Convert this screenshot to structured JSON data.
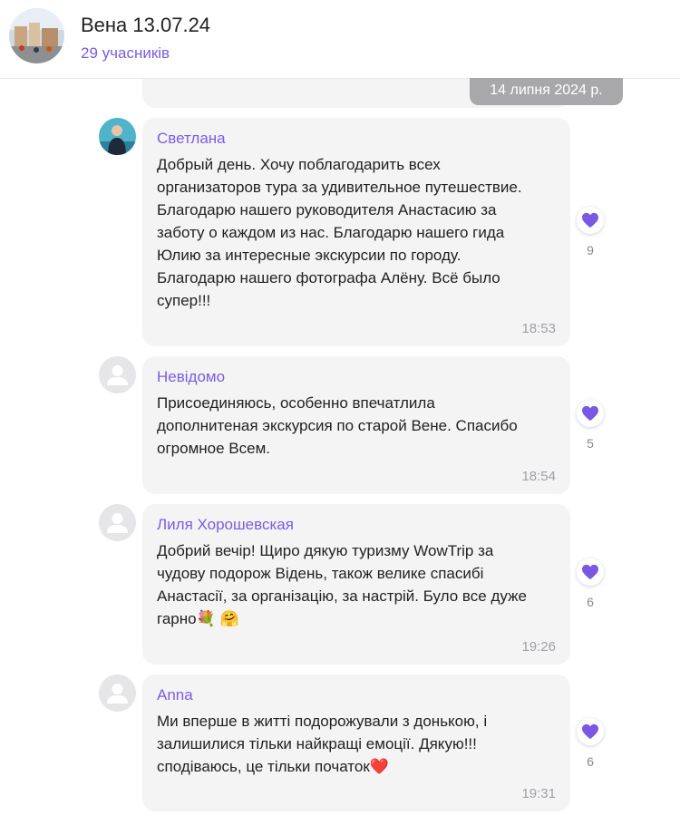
{
  "header": {
    "title": "Вена 13.07.24",
    "subtitle": "29 учасників"
  },
  "date_pill": "14 липня 2024 р.",
  "colors": {
    "accent": "#7b5ce6",
    "bubble": "#f4f4f5",
    "heart": "#7a58e6"
  },
  "messages": [
    {
      "author": "Светлана",
      "lines": [
        "Добрый день. Хочу поблагодарить всех",
        "организаторов тура за удивительное путешествие.",
        "Благодарю нашего руководителя Анастасию за",
        "заботу о каждом из нас. Благодарю нашего гида",
        "Юлию за интересные экскурсии по городу.",
        "Благодарю нашего фотографа Алёну. Всё было",
        "супер!!!"
      ],
      "time": "18:53",
      "likes": "9"
    },
    {
      "author": "Невідомо",
      "lines": [
        "Присоединяюсь, особенно впечатлила",
        "дополнитеная экскурсия по старой Вене. Спасибо",
        "огромное Всем."
      ],
      "time": "18:54",
      "likes": "5"
    },
    {
      "author": "Лиля Хорошевская",
      "lines": [
        "Добрий вечір!  Щиро дякую туризму WowTrip  за",
        "чудову подорож Відень, також  велике спасибі",
        "Анастасії, за організацію, за настрій. Було все дуже",
        "гарно"
      ],
      "emoji_line3": [
        "💐",
        "🤗"
      ],
      "time": "19:26",
      "likes": "6"
    },
    {
      "author": "Anna",
      "lines": [
        "Ми вперше в житті подорожували з донькою, і",
        "залишилися тільки найкращі емоції. Дякую!!!",
        "сподіваюсь, це тільки початок"
      ],
      "emoji_line2": [
        "❤️"
      ],
      "time": "19:31",
      "likes": "6"
    }
  ]
}
